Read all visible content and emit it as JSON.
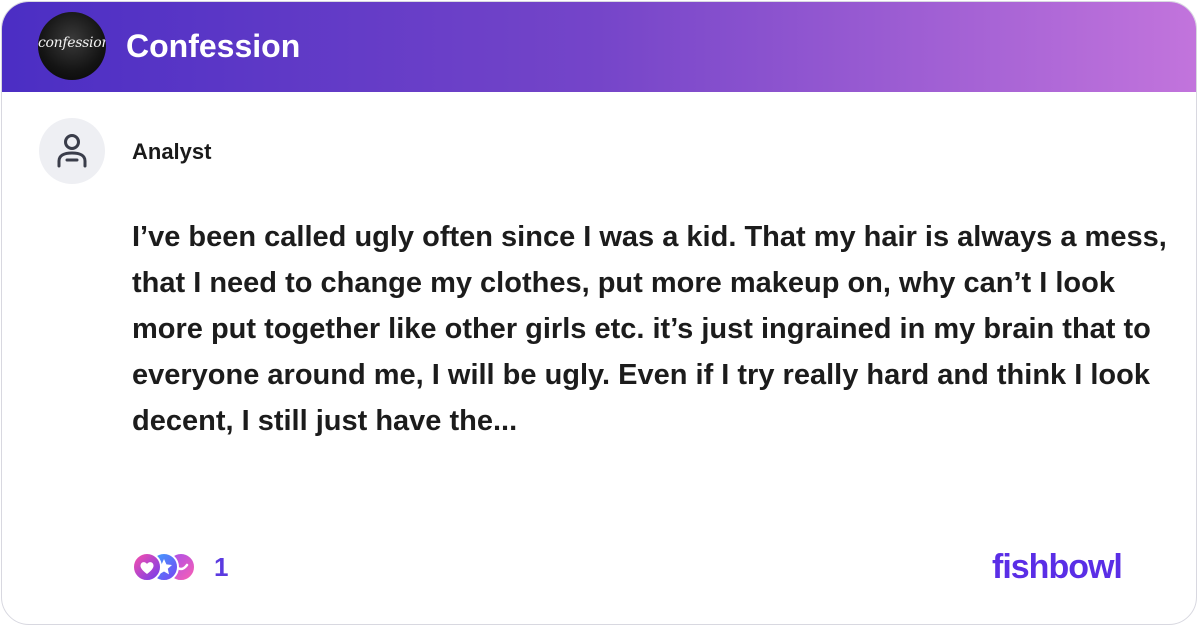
{
  "header": {
    "bowl_logo_text": "confession",
    "bowl_name": "Confession"
  },
  "post": {
    "author": "Analyst",
    "text": "I’ve been called ugly often since I was a kid. That my hair is always a mess, that I need to change my clothes, put more makeup on, why can’t I look more put together like other girls etc. it’s just ingrained in my brain that to everyone around me, I will be ugly. Even if I try really hard and think I look decent, I still just have the..."
  },
  "reactions": {
    "icons": [
      "heart-reaction-icon",
      "star-reaction-icon",
      "smile-reaction-icon"
    ],
    "count": "1"
  },
  "footer": {
    "brand": "fishbowl"
  },
  "colors": {
    "header_gradient_start": "#4b2ec4",
    "header_gradient_end": "#c274dc",
    "brand": "#5a2ee6",
    "count": "#5b3ae0"
  }
}
